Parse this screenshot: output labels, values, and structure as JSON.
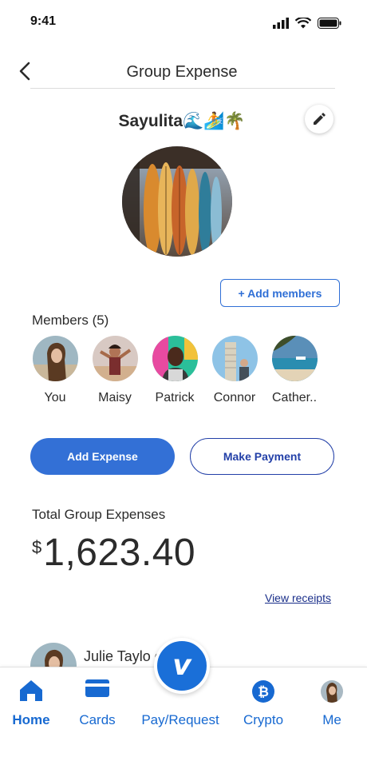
{
  "status_bar": {
    "time": "9:41"
  },
  "header": {
    "title": "Group Expense"
  },
  "group": {
    "name": "Sayulita🌊🏄🌴"
  },
  "actions": {
    "add_members": "+ Add members"
  },
  "members": {
    "title": "Members (5)",
    "list": [
      {
        "name": "You"
      },
      {
        "name": "Maisy"
      },
      {
        "name": "Patrick"
      },
      {
        "name": "Connor"
      },
      {
        "name": "Cather.."
      }
    ]
  },
  "buttons": {
    "add_expense": "Add Expense",
    "make_payment": "Make Payment"
  },
  "totals": {
    "label": "Total Group Expenses",
    "currency": "$",
    "amount": "1,623.40"
  },
  "links": {
    "view_receipts": "View receipts"
  },
  "entry": {
    "name": "Julie Taylo         owe"
  },
  "nav": {
    "items": [
      {
        "label": "Home",
        "icon": "home-icon"
      },
      {
        "label": "Cards",
        "icon": "card-icon"
      },
      {
        "label": "Pay/Request",
        "icon": "venmo-icon"
      },
      {
        "label": "Crypto",
        "icon": "crypto-icon"
      },
      {
        "label": "Me",
        "icon": "profile-avatar"
      }
    ],
    "fab_glyph": "v"
  },
  "colors": {
    "accent": "#3370d6",
    "nav_blue": "#1769d1",
    "link": "#1a2f8a"
  }
}
